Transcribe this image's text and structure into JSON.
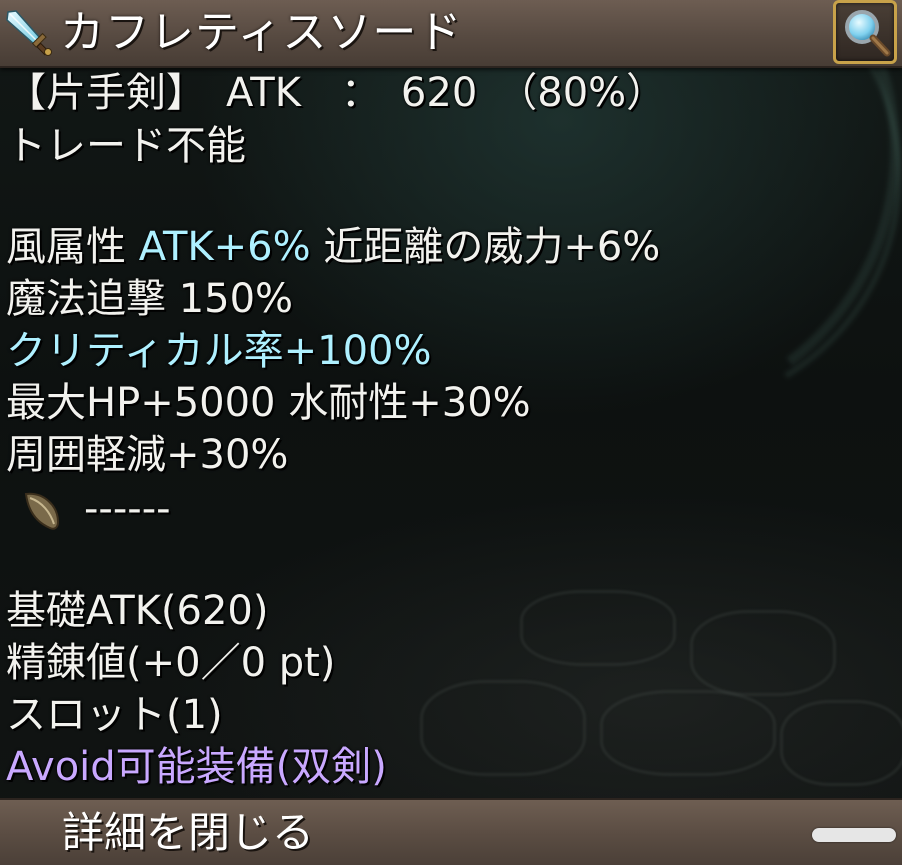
{
  "header": {
    "title": "カフレティスソード",
    "icon": "sword-icon",
    "zoom_icon": "magnifier-icon"
  },
  "item": {
    "type_line": "【片手剣】　ATK　：　620　（80%）",
    "trade_line": "トレード不能",
    "effect_wind_label": "風属性 ",
    "effect_wind_atk": "ATK+6%",
    "effect_melee": " 近距離の威力+6%",
    "effect_magic_followup": "魔法追撃 150%",
    "effect_crit": "クリティカル率+100%",
    "effect_hp_water": "最大HP+5000 水耐性+30%",
    "effect_area_reduction": "周囲軽減+30%",
    "enchant_line": "------",
    "base_atk": "基礎ATK(620)",
    "refine": "精錬値(+0／0 pt)",
    "slots": "スロット(1)",
    "avoid_equip": "Avoid可能装備(双剣)"
  },
  "footer": {
    "close_label": "詳細を閉じる"
  },
  "colors": {
    "header_bg": "#5d4f45",
    "highlight_cyan": "#aef0ff",
    "highlight_violet": "#c9a8ff",
    "zoom_border": "#c8a24a"
  }
}
